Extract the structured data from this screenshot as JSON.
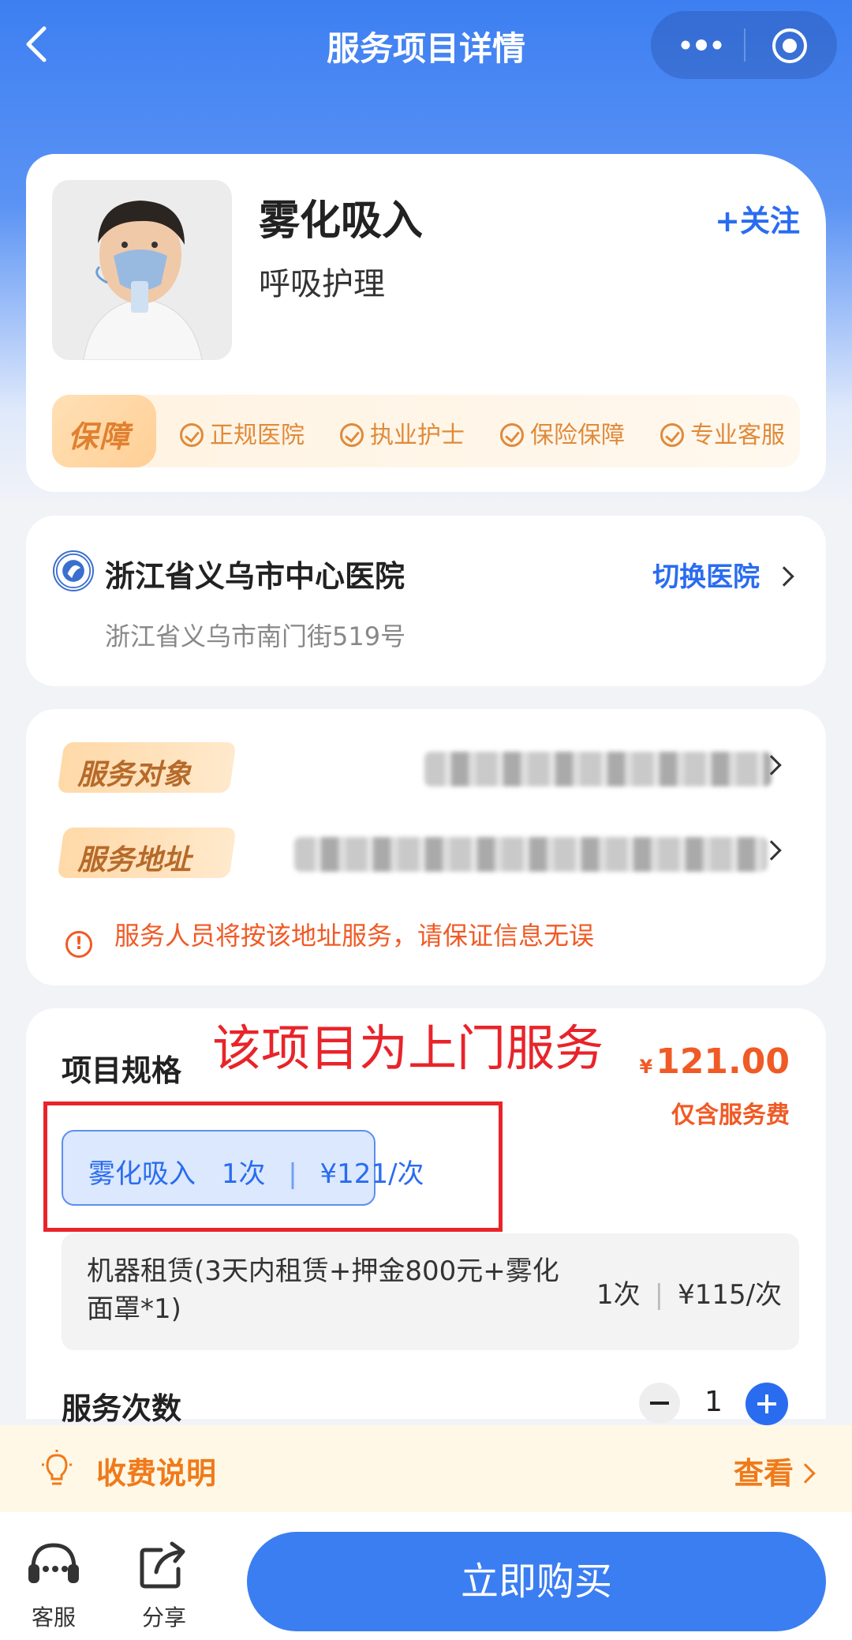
{
  "nav": {
    "title": "服务项目详情"
  },
  "product": {
    "name": "雾化吸入",
    "category": "呼吸护理",
    "follow_label": "+关注",
    "guarantee_badge": "保障",
    "guarantees": [
      "正规医院",
      "执业护士",
      "保险保障",
      "专业客服"
    ]
  },
  "hospital": {
    "name": "浙江省义乌市中心医院",
    "switch_label": "切换医院",
    "address": "浙江省义乌市南门街519号"
  },
  "service_info": {
    "target_tag": "服务对象",
    "address_tag": "服务地址",
    "notice": "服务人员将按该地址服务，请保证信息无误"
  },
  "spec": {
    "label": "项目规格",
    "annotation": "该项目为上门服务",
    "price_symbol": "¥",
    "price": "121.00",
    "price_note": "仅含服务费",
    "options": [
      {
        "name": "雾化吸入",
        "count": "1次",
        "price": "¥121/次",
        "selected": true
      },
      {
        "name": "机器租赁(3天内租赁+押金800元+雾化面罩*1)",
        "count": "1次",
        "price": "¥115/次",
        "selected": false
      }
    ],
    "option_separator": "|"
  },
  "quantity": {
    "label": "服务次数",
    "value": "1"
  },
  "fee": {
    "label": "收费说明",
    "view_label": "查看"
  },
  "bottom_bar": {
    "service_label": "客服",
    "share_label": "分享",
    "buy_label": "立即购买"
  },
  "colors": {
    "primary": "#2a6cf0",
    "accent_orange": "#f05a25",
    "annotation_red": "#e8242a"
  }
}
